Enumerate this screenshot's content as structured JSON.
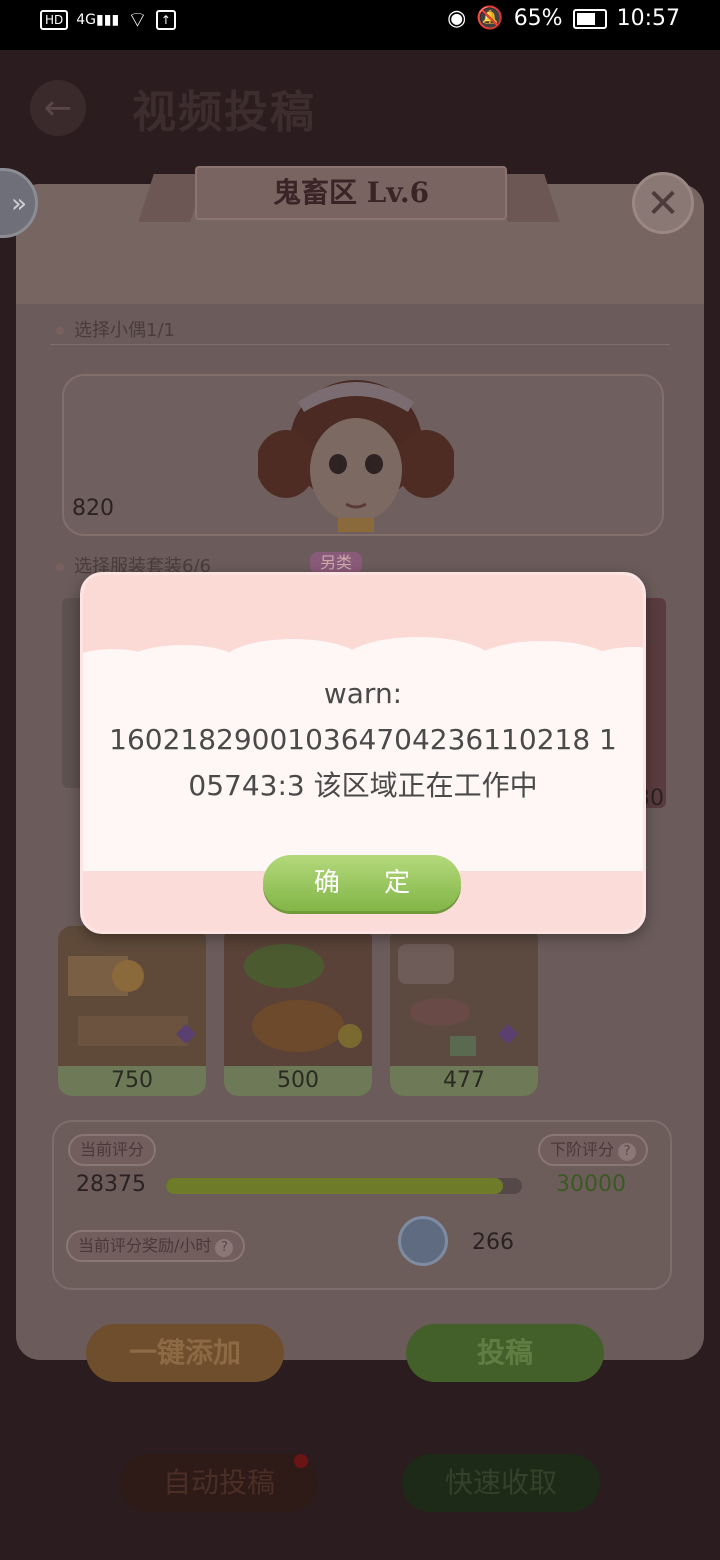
{
  "status_bar": {
    "network_label": "HD",
    "signal_label": "4G",
    "battery": "65%",
    "time": "10:57"
  },
  "header": {
    "back_icon": "back-arrow-icon",
    "title": "视频投稿"
  },
  "panel": {
    "ribbon_title": "鬼畜区 Lv.6",
    "doll_section": {
      "label": "选择小偶1/1",
      "score": "820"
    },
    "costume_section": {
      "label": "选择服装套装6/6",
      "tag": "另类",
      "partial_right_value": "30"
    },
    "cards": [
      {
        "value": "750"
      },
      {
        "value": "500"
      },
      {
        "value": "477"
      }
    ],
    "score": {
      "current_label": "当前评分",
      "current_value": "28375",
      "next_label": "下阶评分",
      "next_value": "30000",
      "progress_fraction": 0.9458,
      "reward_label": "当前评分奖励/小时",
      "reward_value": "266"
    },
    "buttons": {
      "add_all": "一键添加",
      "submit": "投稿",
      "auto_submit": "自动投稿",
      "quick_collect": "快速收取"
    }
  },
  "dialog": {
    "line1": "warn:",
    "line2": "16021829001036470423611021 81",
    "line2_display": "160218290010364704236110218 1",
    "line3": "05743:3  该区域正在工作中",
    "ok": "确  定"
  },
  "colors": {
    "accent_green": "#82b547",
    "dialog_pink": "#fbd9d5"
  }
}
